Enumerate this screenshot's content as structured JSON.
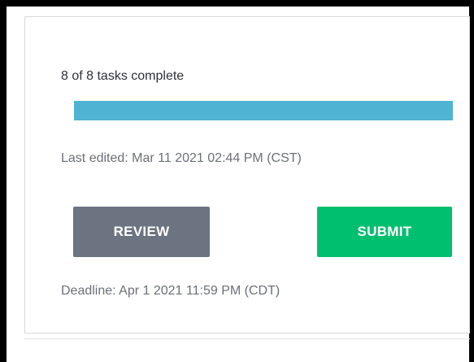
{
  "task_card": {
    "progress_text": "8 of 8 tasks complete",
    "progress_fraction": 1.0,
    "last_edited": "Last edited: Mar 11 2021 02:44 PM (CST)",
    "review_label": "REVIEW",
    "submit_label": "SUBMIT",
    "deadline": "Deadline: Apr 1 2021 11:59 PM (CDT)"
  },
  "colors": {
    "progress_fill": "#4fb3d3",
    "review_button": "#6b7480",
    "submit_button": "#00bf6f"
  }
}
